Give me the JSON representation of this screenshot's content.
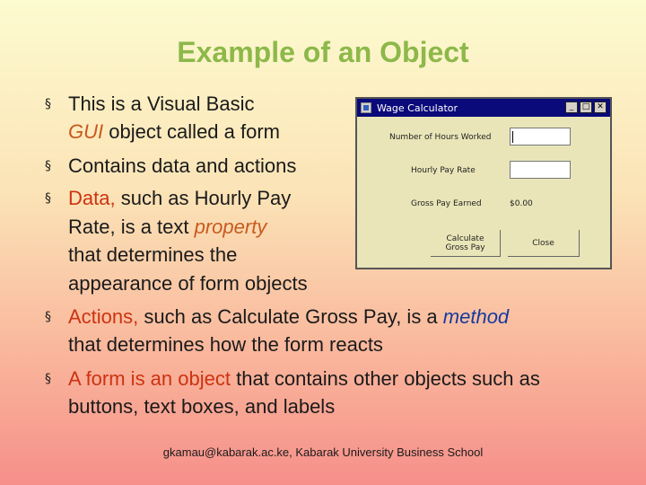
{
  "slide": {
    "title": "Example of an Object",
    "bullets": [
      {
        "lines": [
          [
            "This is a Visual Basic"
          ],
          [
            "GUI",
            " object called a form"
          ]
        ]
      },
      {
        "lines": [
          [
            "Contains data and actions"
          ]
        ]
      },
      {
        "lines": [
          [
            "Data,",
            " such as Hourly Pay"
          ],
          [
            "Rate, is a text ",
            "property"
          ],
          [
            "that determines the"
          ],
          [
            "appearance of form objects"
          ]
        ]
      },
      {
        "lines": [
          [
            "Actions,",
            " such as Calculate Gross Pay, is a ",
            "method"
          ],
          [
            "that determines how the form reacts"
          ]
        ]
      },
      {
        "lines": [
          [
            "A form is an ",
            "object",
            " that contains other objects such as"
          ],
          [
            "buttons, text boxes, and labels"
          ]
        ]
      }
    ],
    "footer": "gkamau@kabarak.ac.ke, Kabarak University Business School"
  },
  "window": {
    "title": "Wage Calculator",
    "minimize": "_",
    "maximize": "□",
    "close": "✕",
    "hours_label": "Number of Hours Worked",
    "rate_label": "Hourly Pay Rate",
    "gross_label": "Gross Pay Earned",
    "gross_value": "$0.00",
    "calc_button_line1": "Calculate",
    "calc_button_line2": "Gross Pay",
    "close_button": "Close"
  },
  "colors": {
    "title": "#8db84a",
    "highlight": "#cc3311",
    "emphasis": "#c85a1e",
    "method": "#163a9e"
  }
}
